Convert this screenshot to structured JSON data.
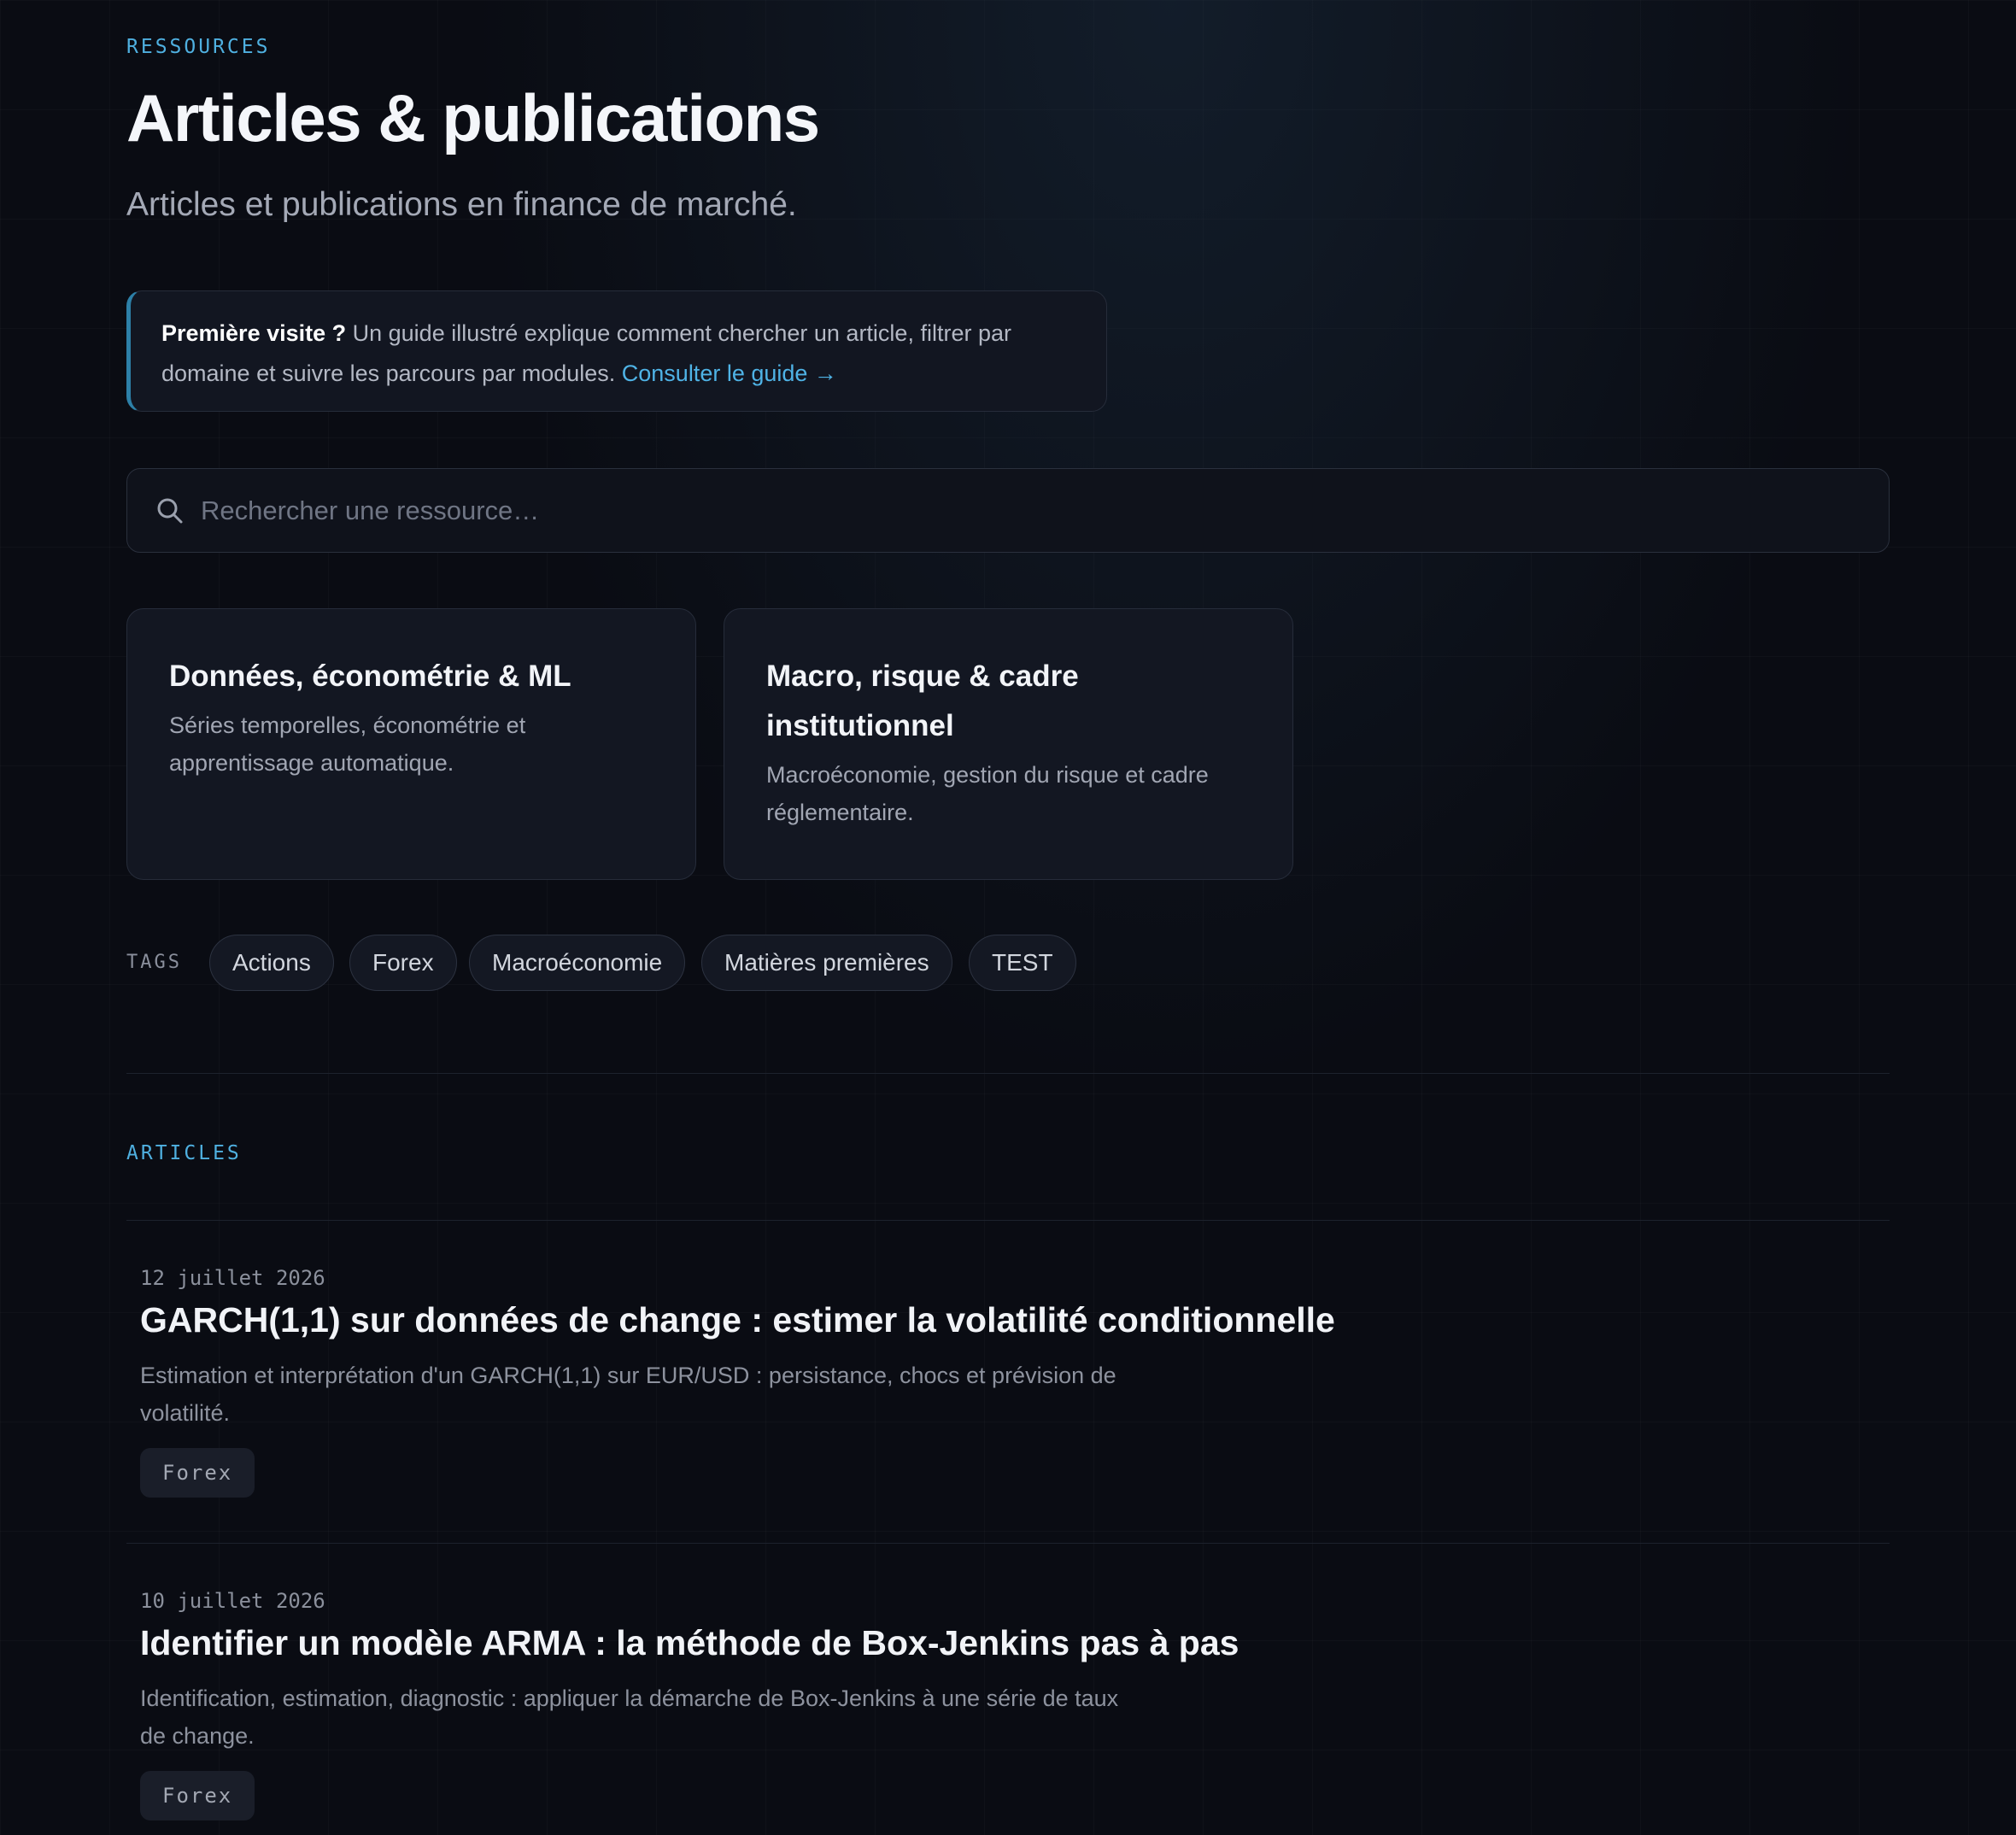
{
  "header": {
    "eyebrow": "RESSOURCES",
    "title": "Articles & publications",
    "subtitle": "Articles et publications en finance de marché."
  },
  "guide": {
    "strong": "Première visite ?",
    "text": " Un guide illustré explique comment chercher un article, filtrer par domaine et suivre les parcours par modules. ",
    "link_label": "Consulter le guide →"
  },
  "search": {
    "placeholder": "Rechercher une ressource…",
    "value": ""
  },
  "domains": [
    {
      "title": "Données, économétrie & ML",
      "description": "Séries temporelles, économétrie et apprentissage automatique."
    },
    {
      "title": "Macro, risque & cadre institutionnel",
      "description": "Macroéconomie, gestion du risque et cadre réglementaire."
    }
  ],
  "tags": {
    "label": "TAGS",
    "items": [
      "Actions",
      "Forex",
      "Macroéconomie",
      "Matières premières",
      "TEST"
    ]
  },
  "articles_section": {
    "label": "ARTICLES",
    "items": [
      {
        "date": "12 juillet 2026",
        "title": "GARCH(1,1) sur données de change : estimer la volatilité conditionnelle",
        "summary": "Estimation et interprétation d'un GARCH(1,1) sur EUR/USD : persistance, chocs et prévision de volatilité.",
        "tag": "Forex"
      },
      {
        "date": "10 juillet 2026",
        "title": "Identifier un modèle ARMA : la méthode de Box-Jenkins pas à pas",
        "summary": "Identification, estimation, diagnostic : appliquer la démarche de Box-Jenkins à une série de taux de change.",
        "tag": "Forex"
      }
    ]
  },
  "colors": {
    "background": "#0a0c13",
    "accent": "#4fb3e6",
    "card": "#131722",
    "border": "#262c3a"
  },
  "icons": {
    "search": "search-icon",
    "link_arrow": "arrow-right-icon"
  }
}
